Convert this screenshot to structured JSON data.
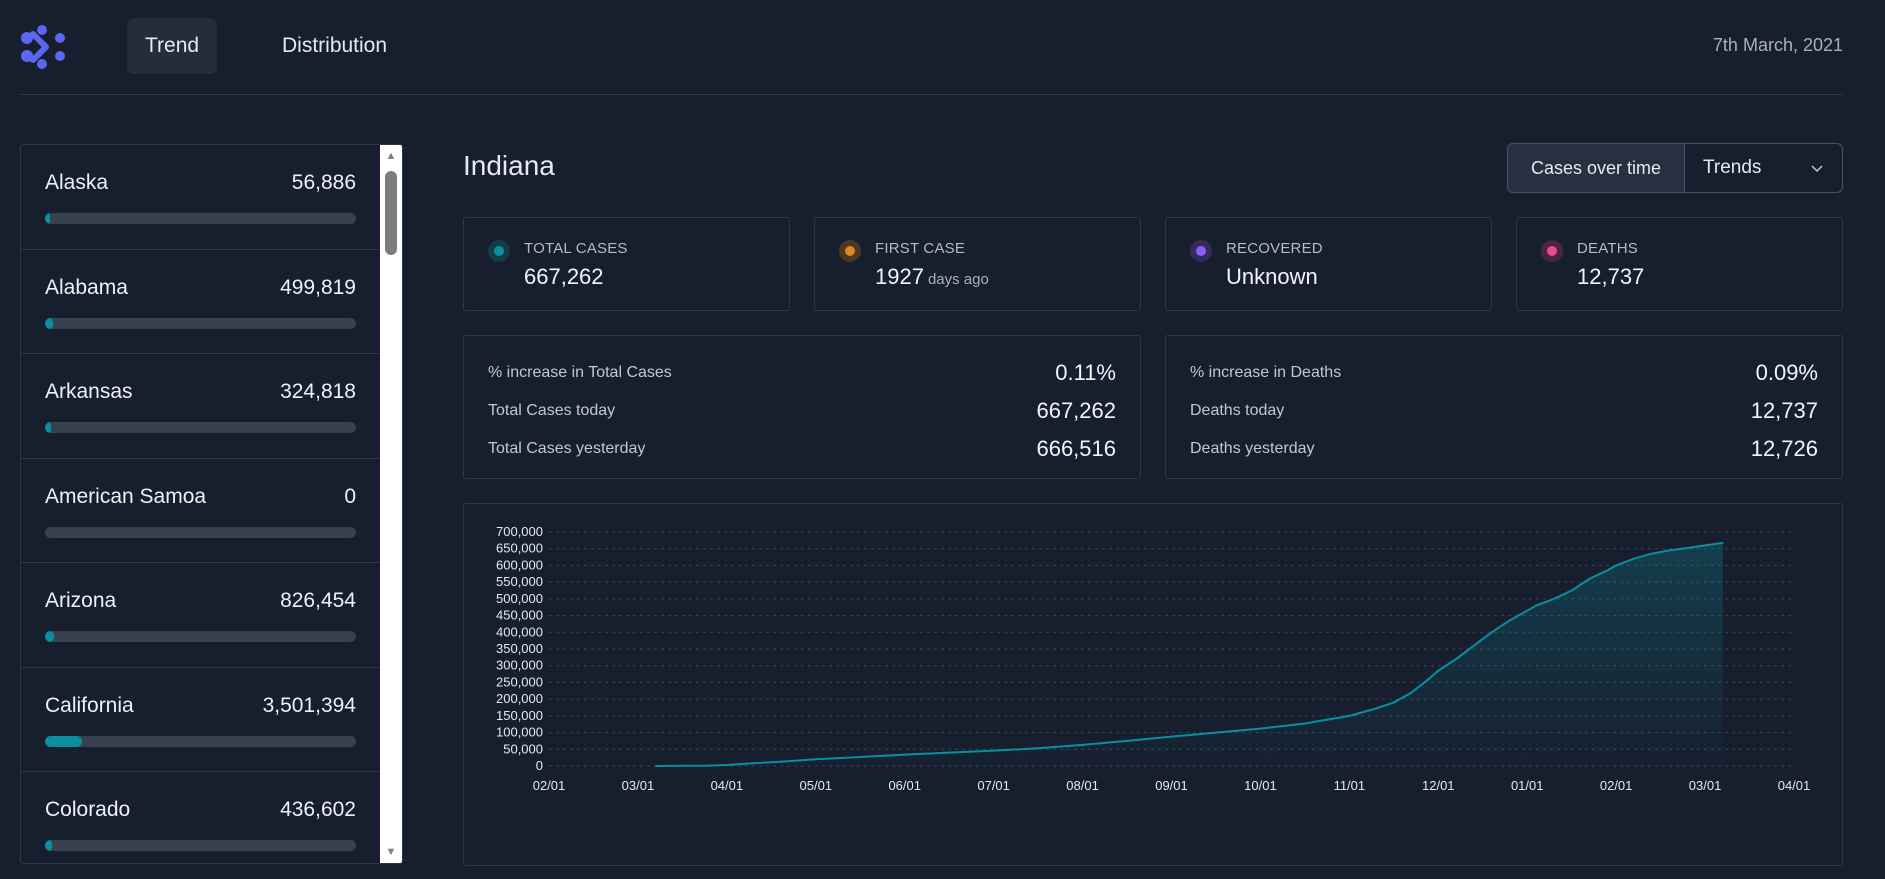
{
  "header": {
    "tabs": [
      {
        "label": "Trend",
        "active": true
      },
      {
        "label": "Distribution",
        "active": false
      }
    ],
    "date": "7th March, 2021",
    "logo_icon": "cluster-logo-icon"
  },
  "sidebar": {
    "states": [
      {
        "name": "Alaska",
        "cases": "56,886",
        "share": 0.016
      },
      {
        "name": "Alabama",
        "cases": "499,819",
        "share": 0.025
      },
      {
        "name": "Arkansas",
        "cases": "324,818",
        "share": 0.02
      },
      {
        "name": "American Samoa",
        "cases": "0",
        "share": 0
      },
      {
        "name": "Arizona",
        "cases": "826,454",
        "share": 0.03
      },
      {
        "name": "California",
        "cases": "3,501,394",
        "share": 0.12
      },
      {
        "name": "Colorado",
        "cases": "436,602",
        "share": 0.022
      }
    ]
  },
  "main": {
    "title": "Indiana",
    "view_mode": "Cases over time",
    "view_dropdown": "Trends",
    "stats": [
      {
        "label": "TOTAL CASES",
        "value": "667,262",
        "suffix": "",
        "color": "#0b8fa0",
        "ring": "#143c47"
      },
      {
        "label": "FIRST CASE",
        "value": "1927",
        "suffix": "days ago",
        "color": "#d98a1a",
        "ring": "#4a3823"
      },
      {
        "label": "RECOVERED",
        "value": "Unknown",
        "suffix": "",
        "color": "#8b5cf6",
        "ring": "#342b5a"
      },
      {
        "label": "DEATHS",
        "value": "12,737",
        "suffix": "",
        "color": "#ec4899",
        "ring": "#4a2540"
      }
    ],
    "cases_detail": [
      {
        "label": "% increase in Total Cases",
        "value": "0.11%"
      },
      {
        "label": "Total Cases today",
        "value": "667,262"
      },
      {
        "label": "Total Cases yesterday",
        "value": "666,516"
      }
    ],
    "deaths_detail": [
      {
        "label": "% increase in Deaths",
        "value": "0.09%"
      },
      {
        "label": "Deaths today",
        "value": "12,737"
      },
      {
        "label": "Deaths yesterday",
        "value": "12,726"
      }
    ]
  },
  "chart_data": {
    "type": "area",
    "x_ticks": [
      "02/01",
      "03/01",
      "04/01",
      "05/01",
      "06/01",
      "07/01",
      "08/01",
      "09/01",
      "10/01",
      "11/01",
      "12/01",
      "01/01",
      "02/01",
      "03/01",
      "04/01"
    ],
    "y_ticks": [
      "0",
      "50,000",
      "100,000",
      "150,000",
      "200,000",
      "250,000",
      "300,000",
      "350,000",
      "400,000",
      "450,000",
      "500,000",
      "550,000",
      "600,000",
      "650,000",
      "700,000"
    ],
    "ylim": [
      0,
      700000
    ],
    "xlim": [
      0,
      14
    ],
    "grid": true,
    "color": "#0b8fa0",
    "x": [
      1.2,
      1.5,
      1.8,
      2.0,
      2.3,
      2.6,
      3.0,
      3.5,
      4.0,
      4.5,
      5.0,
      5.5,
      6.0,
      6.5,
      7.0,
      7.5,
      8.0,
      8.5,
      9.0,
      9.3,
      9.5,
      9.7,
      9.9,
      10.0,
      10.2,
      10.4,
      10.6,
      10.8,
      11.0,
      11.1,
      11.3,
      11.5,
      11.7,
      11.9,
      12.0,
      12.2,
      12.4,
      12.6,
      12.8,
      13.0,
      13.2
    ],
    "y": [
      0,
      500,
      1200,
      3000,
      8000,
      13000,
      20000,
      27000,
      34000,
      40000,
      46000,
      53000,
      63000,
      75000,
      88000,
      100000,
      112000,
      127000,
      150000,
      172000,
      190000,
      220000,
      262000,
      285000,
      320000,
      360000,
      400000,
      435000,
      465000,
      480000,
      500000,
      525000,
      560000,
      585000,
      600000,
      620000,
      635000,
      645000,
      652000,
      660000,
      667262
    ]
  }
}
